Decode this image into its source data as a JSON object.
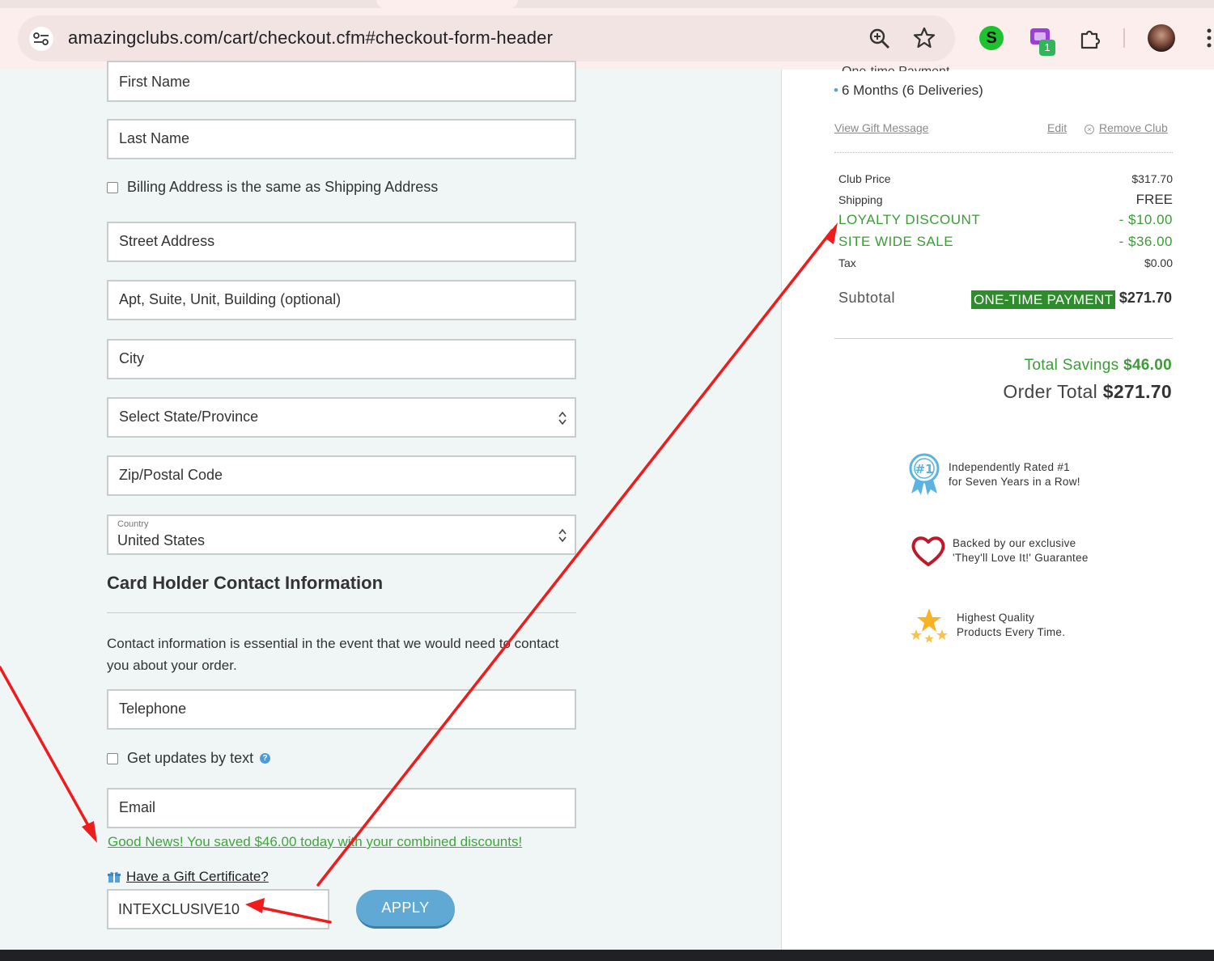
{
  "browser": {
    "url": "amazingclubs.com/cart/checkout.cfm#checkout-form-header",
    "extension_badge": "1",
    "extension_s_label": "S"
  },
  "form": {
    "first_name_placeholder": "First Name",
    "last_name_placeholder": "Last Name",
    "billing_same_label": "Billing Address is the same as Shipping Address",
    "street_placeholder": "Street Address",
    "apt_placeholder": "Apt, Suite, Unit, Building (optional)",
    "city_placeholder": "City",
    "state_select": "Select State/Province",
    "zip_placeholder": "Zip/Postal Code",
    "country_label": "Country",
    "country_value": "United States",
    "contact_heading": "Card Holder Contact Information",
    "contact_description": "Contact information is essential in the event that we would need to contact you about your order.",
    "telephone_placeholder": "Telephone",
    "text_updates_label": "Get updates by text",
    "help_glyph": "?",
    "email_placeholder": "Email",
    "savings_message": "Good News! You saved $46.00 today with your combined discounts!",
    "gift_certificate_link": "Have a Gift Certificate?",
    "coupon_value": "INTEXCLUSIVE10",
    "apply_button": "APPLY"
  },
  "summary": {
    "cutoff_text": "One-time Payment",
    "delivery": "6 Months (6 Deliveries)",
    "view_gift_message": "View Gift Message",
    "edit": "Edit",
    "remove_club": "Remove Club",
    "remove_glyph": "×",
    "rows": [
      {
        "label": "Club Price",
        "value": "$317.70"
      },
      {
        "label": "Shipping",
        "value": "FREE"
      },
      {
        "label": "LOYALTY DISCOUNT",
        "value": "- $10.00"
      },
      {
        "label": "SITE WIDE SALE",
        "value": "- $36.00"
      },
      {
        "label": "Tax",
        "value": "$0.00"
      }
    ],
    "subtotal_label": "Subtotal",
    "one_time_badge": "ONE-TIME PAYMENT",
    "subtotal_value": "$271.70",
    "total_savings_label": "Total Savings",
    "total_savings_value": "$46.00",
    "order_total_label": "Order Total",
    "order_total_value": "$271.70",
    "colors": {
      "green": "#3a9d36",
      "badge_green": "#2f8c2c",
      "apply_blue": "#5fa9d4",
      "annotation_red": "#ee1c1c"
    }
  },
  "trust_badges": [
    {
      "icon": "award-ribbon-icon",
      "line1": "Independently Rated #1",
      "line2": "for Seven Years in a Row!"
    },
    {
      "icon": "heart-icon",
      "line1": "Backed by our exclusive",
      "line2": "'They'll Love It!' Guarantee"
    },
    {
      "icon": "stars-icon",
      "line1": "Highest Quality",
      "line2": "Products Every Time."
    }
  ]
}
